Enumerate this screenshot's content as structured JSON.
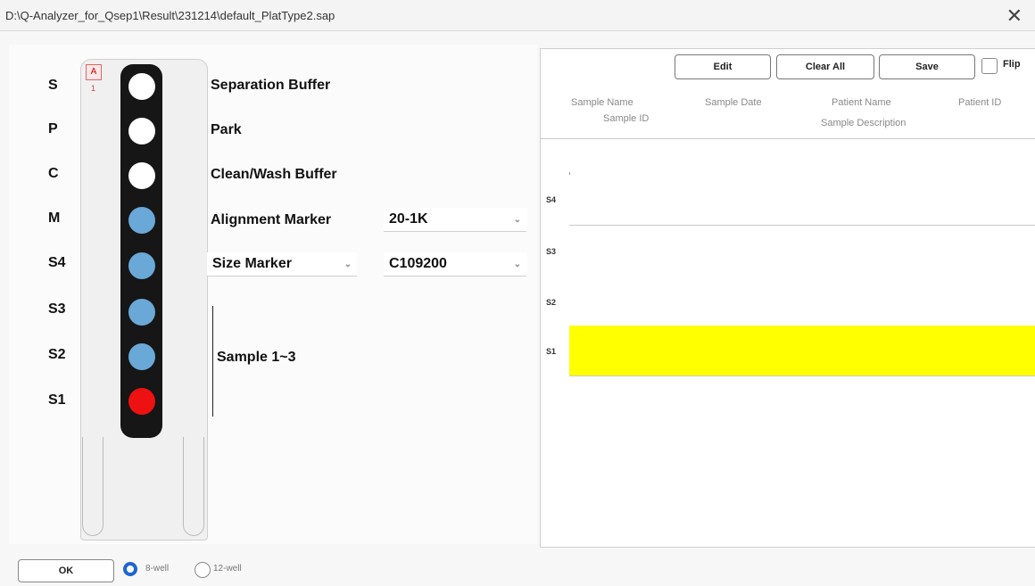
{
  "window": {
    "title": "D:\\Q-Analyzer_for_Qsep1\\Result\\231214\\default_PlatType2.sap"
  },
  "cartridge": {
    "row_labels": [
      "S",
      "P",
      "C",
      "M",
      "S4",
      "S3",
      "S2",
      "S1"
    ],
    "marker_glyph": "A",
    "marker_number": "1",
    "wells": [
      {
        "label": "S",
        "color": "#ffffff"
      },
      {
        "label": "P",
        "color": "#ffffff"
      },
      {
        "label": "C",
        "color": "#ffffff"
      },
      {
        "label": "M",
        "color": "#6aa8d8"
      },
      {
        "label": "S4",
        "color": "#6aa8d8"
      },
      {
        "label": "S3",
        "color": "#6aa8d8"
      },
      {
        "label": "S2",
        "color": "#6aa8d8"
      },
      {
        "label": "S1",
        "color": "#ee1111"
      }
    ]
  },
  "descriptions": {
    "separation": "Separation Buffer",
    "park": "Park",
    "clean": "Clean/Wash Buffer",
    "alignment": "Alignment Marker",
    "size": "Size Marker",
    "samples": "Sample 1~3"
  },
  "dropdowns": {
    "alignment_value": "20-1K",
    "size_type_value": "",
    "size_value": "C109200"
  },
  "toolbar": {
    "edit": "Edit",
    "clear_all": "Clear All",
    "save": "Save",
    "flip": "Flip",
    "flip_checked": false
  },
  "table": {
    "headers_row1": [
      "Sample Name",
      "Sample Date",
      "Patient Name",
      "Patient ID"
    ],
    "headers_row2": [
      "Sample ID",
      "Sample Description"
    ],
    "rows": [
      {
        "label": "S4",
        "highlighted": false
      },
      {
        "label": "S3",
        "highlighted": false
      },
      {
        "label": "S2",
        "highlighted": false
      },
      {
        "label": "S1",
        "highlighted": true
      }
    ],
    "highlight_color": "#ffff00"
  },
  "footer": {
    "ok": "OK",
    "opt_a": "8-well",
    "opt_b": "12-well",
    "selected": "8-well"
  },
  "accent_color": "#1e66d0"
}
